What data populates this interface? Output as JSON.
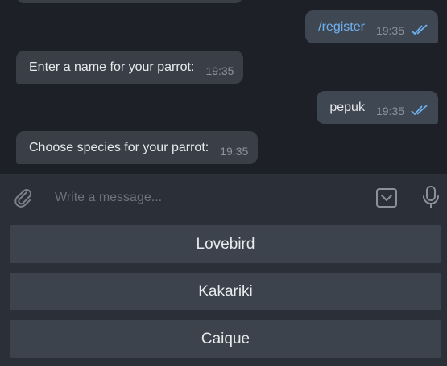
{
  "messages": [
    {
      "direction": "in",
      "text": "",
      "time": ""
    },
    {
      "direction": "out",
      "text": "/register",
      "time": "19:35",
      "read": true
    },
    {
      "direction": "in",
      "text": "Enter a name for your parrot:",
      "time": "19:35"
    },
    {
      "direction": "out",
      "text": "pepuk",
      "time": "19:35",
      "read": true
    },
    {
      "direction": "in",
      "text": "Choose species for your parrot:",
      "time": "19:35"
    }
  ],
  "composer": {
    "placeholder": "Write a message...",
    "attach_icon": "paperclip-icon",
    "keyboard_icon": "bot-keyboard-icon",
    "mic_icon": "microphone-icon"
  },
  "keyboard": {
    "buttons": [
      "Lovebird",
      "Kakariki",
      "Caique"
    ]
  },
  "colors": {
    "background": "#1d2127",
    "incoming_bubble": "#3a3f47",
    "outgoing_bubble": "#3f4752",
    "link": "#6fb0f0",
    "read_check": "#6fb0f0",
    "composer_bg": "#2b3038",
    "keyboard_button": "#3d434c"
  }
}
